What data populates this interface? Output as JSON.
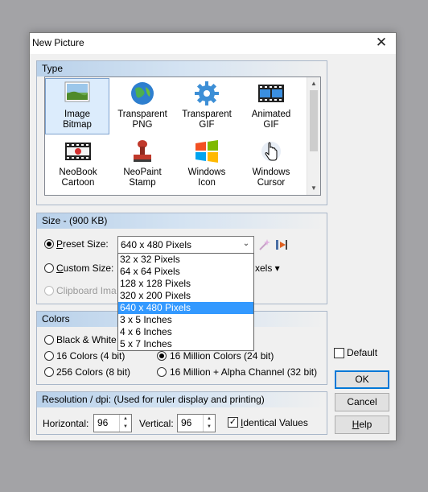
{
  "dialog": {
    "title": "New Picture",
    "close": "✕"
  },
  "type_group": {
    "label": "Type",
    "items": [
      {
        "line1": "Image",
        "line2": "Bitmap",
        "icon": "image-bitmap-icon"
      },
      {
        "line1": "Transparent",
        "line2": "PNG",
        "icon": "transparent-png-icon"
      },
      {
        "line1": "Transparent",
        "line2": "GIF",
        "icon": "transparent-gif-icon"
      },
      {
        "line1": "Animated",
        "line2": "GIF",
        "icon": "animated-gif-icon"
      },
      {
        "line1": "NeoBook",
        "line2": "Cartoon",
        "icon": "neobook-cartoon-icon"
      },
      {
        "line1": "NeoPaint",
        "line2": "Stamp",
        "icon": "neopaint-stamp-icon"
      },
      {
        "line1": "Windows",
        "line2": "Icon",
        "icon": "windows-icon-icon"
      },
      {
        "line1": "Windows",
        "line2": "Cursor",
        "icon": "windows-cursor-icon"
      }
    ],
    "selected": "Image Bitmap"
  },
  "size_group": {
    "label": "Size - (900 KB)",
    "preset_label_u": "P",
    "preset_label_rest": "reset Size:",
    "custom_label_u": "C",
    "custom_label_rest": "ustom Size:",
    "custom_units": "xels ▾",
    "clipboard_label": "Clipboard Ima",
    "preset_value": "640 x 480 Pixels",
    "preset_options": [
      "32 x 32 Pixels",
      "64 x 64 Pixels",
      "128 x 128 Pixels",
      "320 x 200 Pixels",
      "640 x 480 Pixels",
      "3 x 5 Inches",
      "4 x 6 Inches",
      "5 x 7 Inches"
    ]
  },
  "colors_group": {
    "label": "Colors",
    "options": [
      "Black & White",
      "16 Colors (4 bit)",
      "256 Colors (8 bit)",
      "16 Million Colors (24 bit)",
      "16 Million + Alpha Channel (32 bit)"
    ],
    "selected": "16 Million Colors (24 bit)"
  },
  "default_checkbox": {
    "label": "Default",
    "checked": false
  },
  "buttons": {
    "ok": "OK",
    "cancel": "Cancel",
    "help": "Help"
  },
  "resolution_group": {
    "label": "Resolution / dpi:  (Used for ruler display and printing)",
    "horizontal_label": "Horizontal:",
    "horizontal_value": "96",
    "vertical_label": "Vertical:",
    "vertical_value": "96",
    "identical_label": "Identical Values",
    "identical_checked": true
  }
}
